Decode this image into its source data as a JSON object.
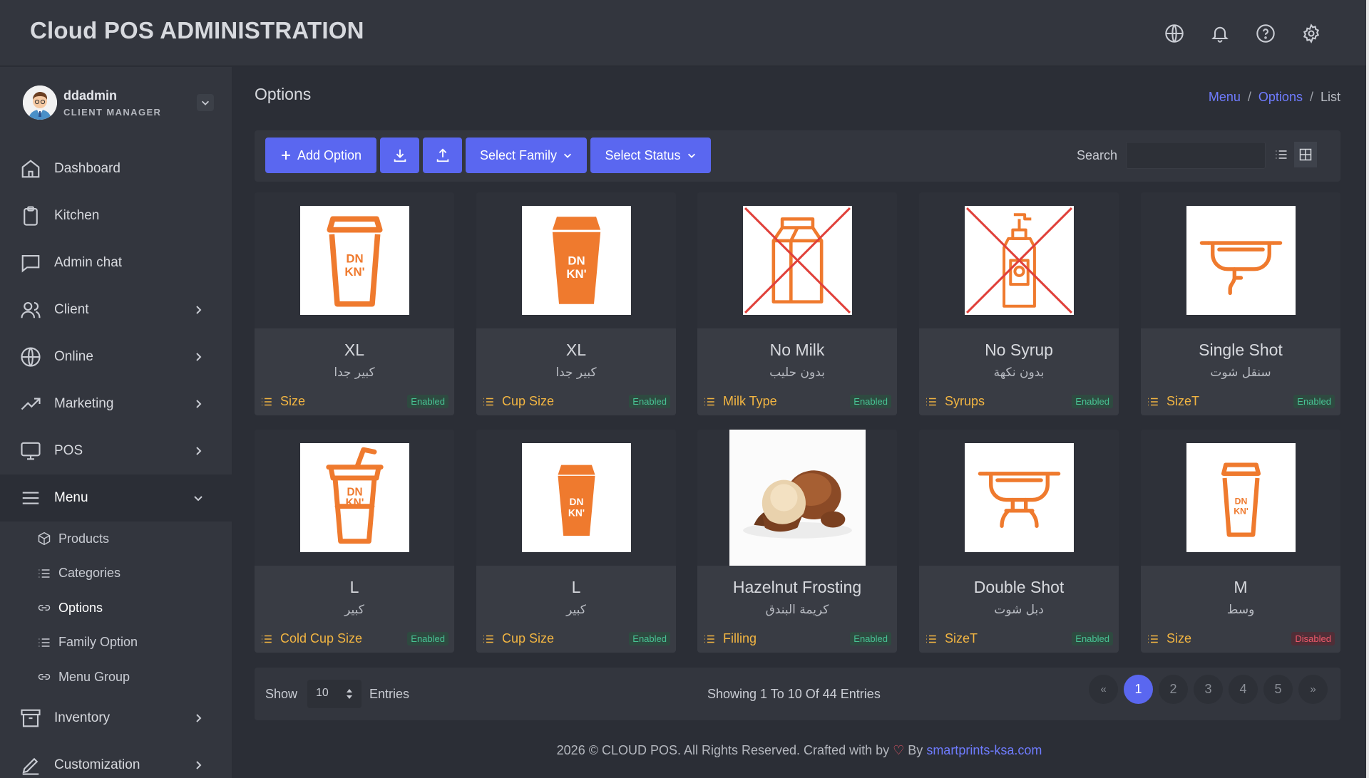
{
  "app_title": "Cloud POS ADMINISTRATION",
  "topbar_icons": [
    "globe-icon",
    "bell-icon",
    "help-icon",
    "gear-icon"
  ],
  "user": {
    "name": "ddadmin",
    "role": "CLIENT MANAGER"
  },
  "nav": {
    "dashboard": "Dashboard",
    "kitchen": "Kitchen",
    "admin_chat": "Admin chat",
    "client": "Client",
    "online": "Online",
    "marketing": "Marketing",
    "pos": "POS",
    "menu": "Menu",
    "inventory": "Inventory",
    "customization": "Customization"
  },
  "menu_sub": {
    "products": "Products",
    "categories": "Categories",
    "options": "Options",
    "family_option": "Family Option",
    "menu_group": "Menu Group"
  },
  "page": {
    "title": "Options",
    "breadcrumb": {
      "menu": "Menu",
      "options": "Options",
      "current": "List",
      "sep": "/"
    }
  },
  "toolbar": {
    "add_option": "Add Option",
    "select_family": "Select Family",
    "select_status": "Select Status",
    "search_label": "Search",
    "search_value": ""
  },
  "cards": [
    {
      "name": "XL",
      "name_ar": "كبير جدا",
      "family": "Size",
      "status": "Enabled",
      "image": "hot-cup-icon"
    },
    {
      "name": "XL",
      "name_ar": "كبير جدا",
      "family": "Cup Size",
      "status": "Enabled",
      "image": "solid-cup-icon"
    },
    {
      "name": "No Milk",
      "name_ar": "بدون حليب",
      "family": "Milk Type",
      "status": "Enabled",
      "image": "milk-carton-crossed-icon"
    },
    {
      "name": "No Syrup",
      "name_ar": "بدون نكهة",
      "family": "Syrups",
      "status": "Enabled",
      "image": "syrup-bottle-crossed-icon"
    },
    {
      "name": "Single Shot",
      "name_ar": "سنقل شوت",
      "family": "SizeT",
      "status": "Enabled",
      "image": "espresso-single-icon"
    },
    {
      "name": "L",
      "name_ar": "كبير",
      "family": "Cold Cup Size",
      "status": "Enabled",
      "image": "cold-cup-icon"
    },
    {
      "name": "L",
      "name_ar": "كبير",
      "family": "Cup Size",
      "status": "Enabled",
      "image": "solid-cup-icon"
    },
    {
      "name": "Hazelnut Frosting",
      "name_ar": "كريمة البندق",
      "family": "Filling",
      "status": "Enabled",
      "image": "hazelnut-photo"
    },
    {
      "name": "Double Shot",
      "name_ar": "دبل شوت",
      "family": "SizeT",
      "status": "Enabled",
      "image": "espresso-double-icon"
    },
    {
      "name": "M",
      "name_ar": "وسط",
      "family": "Size",
      "status": "Disabled",
      "image": "hot-cup-small-icon"
    }
  ],
  "pagination": {
    "show_label": "Show",
    "entries_value": "10",
    "entries_label": "Entries",
    "info": "Showing 1 To 10 Of 44 Entries",
    "prev": "«",
    "pages": [
      "1",
      "2",
      "3",
      "4",
      "5"
    ],
    "next": "»",
    "current_page": "1"
  },
  "footer": {
    "text": "2026 © CLOUD POS. All Rights Reserved. Crafted with by",
    "heart": "♡",
    "by": "By",
    "link": "smartprints-ksa.com"
  },
  "colors": {
    "accent": "#5a67f0",
    "link": "#6f7cff",
    "family": "#f2b542",
    "enabled": "#48c394",
    "disabled": "#f05a6b",
    "brand_orange": "#ef7a2e",
    "cross_red": "#e0403a"
  }
}
